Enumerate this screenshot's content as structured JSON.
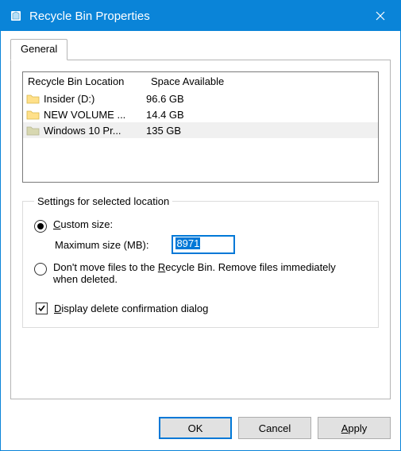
{
  "window": {
    "title": "Recycle Bin Properties"
  },
  "tabs": {
    "general": "General"
  },
  "list": {
    "headers": {
      "location": "Recycle Bin Location",
      "space": "Space Available"
    },
    "rows": [
      {
        "name": "Insider (D:)",
        "space": "96.6 GB",
        "selected": false
      },
      {
        "name": "NEW VOLUME ...",
        "space": "14.4 GB",
        "selected": false
      },
      {
        "name": "Windows 10 Pr...",
        "space": "135 GB",
        "selected": true
      }
    ]
  },
  "settings": {
    "legend": "Settings for selected location",
    "custom_size_pre": "C",
    "custom_size_rest": "ustom size:",
    "max_size_label": "Maximum size (MB):",
    "max_size_value": "8971",
    "dont_move_pre": "Don't move files to the R",
    "dont_move_rest": "ecycle Bin. Remove files immediately when deleted.",
    "custom_selected": true
  },
  "confirm": {
    "pre": "D",
    "rest": "isplay delete confirmation dialog",
    "checked": true
  },
  "buttons": {
    "ok": "OK",
    "cancel": "Cancel",
    "apply_pre": "A",
    "apply_rest": "pply"
  }
}
